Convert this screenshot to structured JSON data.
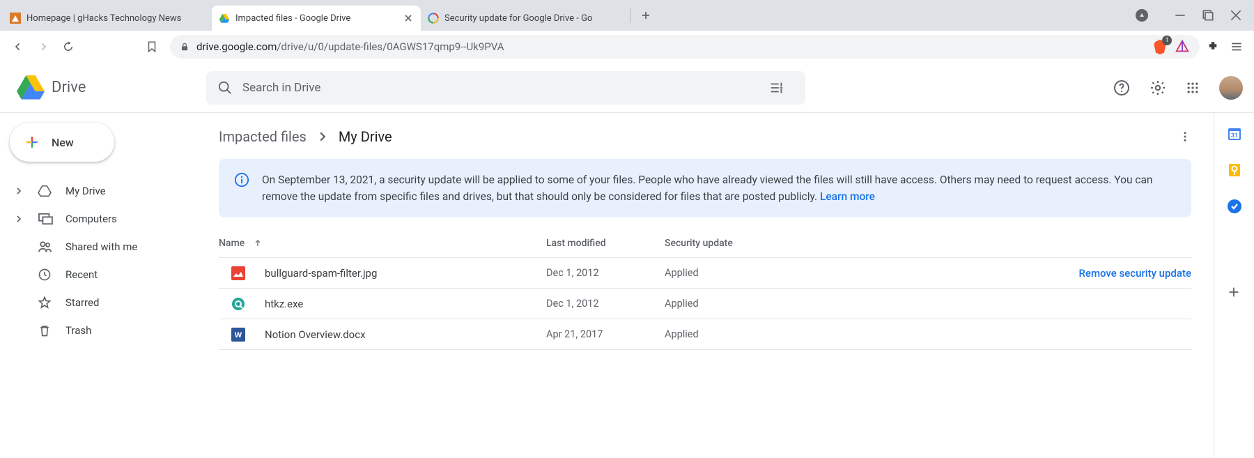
{
  "browser": {
    "tabs": [
      {
        "title": "Homepage | gHacks Technology News",
        "active": false
      },
      {
        "title": "Impacted files - Google Drive",
        "active": true
      },
      {
        "title": "Security update for Google Drive - Go",
        "active": false
      }
    ],
    "brave_count": "1",
    "url_host": "drive.google.com",
    "url_path": "/drive/u/0/update-files/0AGWS17qmp9--Uk9PVA"
  },
  "drive": {
    "product": "Drive",
    "search_placeholder": "Search in Drive",
    "new_label": "New",
    "nav": [
      {
        "label": "My Drive",
        "expandable": true
      },
      {
        "label": "Computers",
        "expandable": true
      },
      {
        "label": "Shared with me",
        "expandable": false
      },
      {
        "label": "Recent",
        "expandable": false
      },
      {
        "label": "Starred",
        "expandable": false
      },
      {
        "label": "Trash",
        "expandable": false
      }
    ],
    "breadcrumb": {
      "root": "Impacted files",
      "current": "My Drive"
    },
    "banner": {
      "text": "On September 13, 2021, a security update will be applied to some of your files. People who have already viewed the files will still have access. Others may need to request access. You can remove the update from specific files and drives, but that should only be considered for files that are posted publicly. ",
      "link": "Learn more"
    },
    "columns": {
      "name": "Name",
      "modified": "Last modified",
      "security": "Security update"
    },
    "rows": [
      {
        "name": "bullguard-spam-filter.jpg",
        "modified": "Dec 1, 2012",
        "security": "Applied",
        "type": "image",
        "action": "Remove security update"
      },
      {
        "name": "htkz.exe",
        "modified": "Dec 1, 2012",
        "security": "Applied",
        "type": "exe",
        "action": ""
      },
      {
        "name": "Notion Overview.docx",
        "modified": "Apr 21, 2017",
        "security": "Applied",
        "type": "word",
        "action": ""
      }
    ]
  }
}
